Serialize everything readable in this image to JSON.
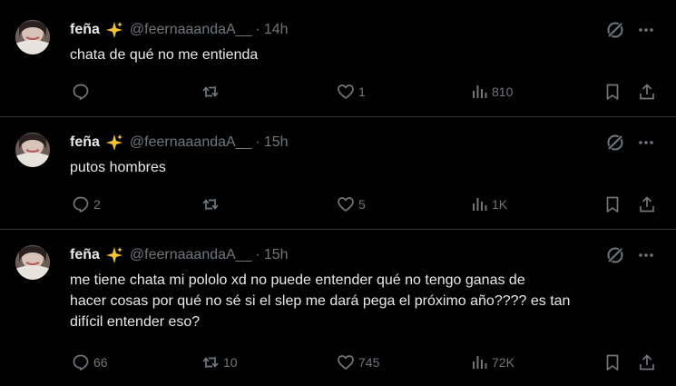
{
  "colors": {
    "background": "#000000",
    "text": "#e7e9ea",
    "muted": "#71767b",
    "divider": "#2f3336"
  },
  "tweets": [
    {
      "name": "feña",
      "emoji": "sparkles-emoji",
      "handle": "@feernaaandaA__",
      "separator": "·",
      "time": "14h",
      "lines": [
        "chata de qué no me entienda"
      ],
      "replies": "",
      "retweets": "",
      "likes": "1",
      "views": "810"
    },
    {
      "name": "feña",
      "emoji": "sparkles-emoji",
      "handle": "@feernaaandaA__",
      "separator": "·",
      "time": "15h",
      "lines": [
        "putos hombres"
      ],
      "replies": "2",
      "retweets": "",
      "likes": "5",
      "views": "1K"
    },
    {
      "name": "feña",
      "emoji": "sparkles-emoji",
      "handle": "@feernaaandaA__",
      "separator": "·",
      "time": "15h",
      "lines": [
        "me tiene chata mi pololo xd no puede entender qué no tengo ganas de",
        "hacer cosas por qué no sé si el slep me dará pega el próximo año???? es tan",
        "difícil entender eso?"
      ],
      "replies": "66",
      "retweets": "10",
      "likes": "745",
      "views": "72K"
    }
  ]
}
